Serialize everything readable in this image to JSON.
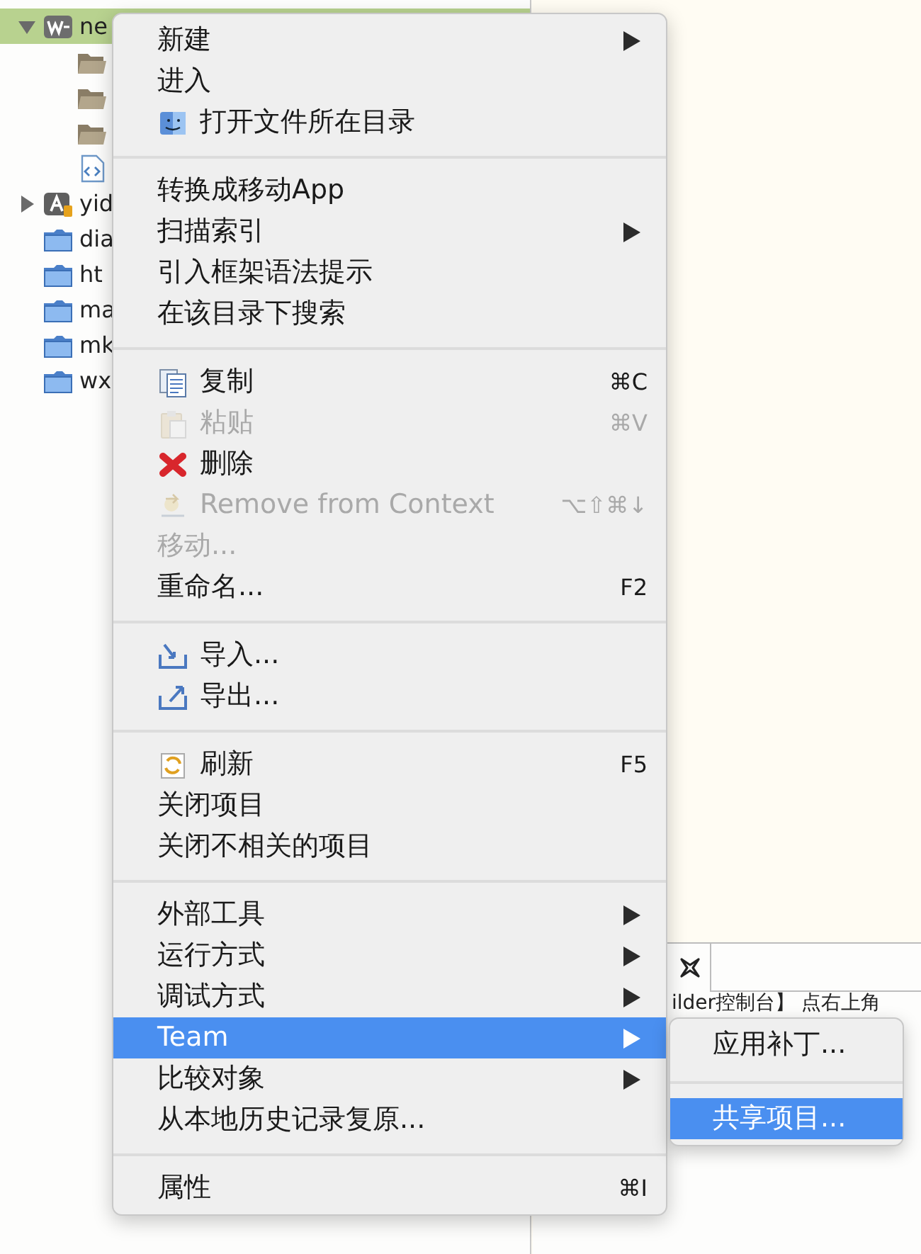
{
  "tree": [
    {
      "kind": "web-project",
      "label": "ne",
      "expanded": true,
      "selected": true,
      "children": [
        {
          "kind": "open-folder"
        },
        {
          "kind": "open-folder"
        },
        {
          "kind": "open-folder"
        },
        {
          "kind": "code-file"
        }
      ]
    },
    {
      "kind": "app-project",
      "label": "yid",
      "expanded": false,
      "selected": false
    },
    {
      "kind": "folder",
      "label": "dia",
      "selected": false
    },
    {
      "kind": "folder",
      "label": "ht",
      "selected": false
    },
    {
      "kind": "folder",
      "label": "ma",
      "selected": false
    },
    {
      "kind": "folder",
      "label": "mk",
      "selected": false
    },
    {
      "kind": "folder",
      "label": "wx",
      "selected": false
    }
  ],
  "console": {
    "text": "ilder控制台】 点右上角"
  },
  "context_menu": {
    "sections": [
      [
        {
          "label": "新建",
          "submenu": true,
          "disabled": false,
          "selected": false
        },
        {
          "label": "进入",
          "submenu": false,
          "disabled": false,
          "selected": false
        },
        {
          "label": "打开文件所在目录",
          "kind": "finder",
          "submenu": false,
          "disabled": false,
          "selected": false
        }
      ],
      [
        {
          "label": "转换成移动App",
          "submenu": false,
          "disabled": false,
          "selected": false
        },
        {
          "label": "扫描索引",
          "submenu": true,
          "disabled": false,
          "selected": false
        },
        {
          "label": "引入框架语法提示",
          "submenu": false,
          "disabled": false,
          "selected": false
        },
        {
          "label": "在该目录下搜索",
          "submenu": false,
          "disabled": false,
          "selected": false
        }
      ],
      [
        {
          "label": "复制",
          "kind": "copy",
          "shortcut": "⌘C",
          "submenu": false,
          "disabled": false,
          "selected": false
        },
        {
          "label": "粘贴",
          "kind": "paste",
          "shortcut": "⌘V",
          "submenu": false,
          "disabled": true,
          "selected": false
        },
        {
          "label": "删除",
          "kind": "delete",
          "submenu": false,
          "disabled": false,
          "selected": false
        },
        {
          "label": "Remove from Context",
          "kind": "remove",
          "shortcut": "⌥⇧⌘↓",
          "submenu": false,
          "disabled": true,
          "selected": false
        },
        {
          "label": "移动...",
          "submenu": false,
          "disabled": true,
          "selected": false
        },
        {
          "label": "重命名...",
          "shortcut": "F2",
          "submenu": false,
          "disabled": false,
          "selected": false
        }
      ],
      [
        {
          "label": "导入...",
          "kind": "import",
          "submenu": false,
          "disabled": false,
          "selected": false
        },
        {
          "label": "导出...",
          "kind": "export",
          "submenu": false,
          "disabled": false,
          "selected": false
        }
      ],
      [
        {
          "label": "刷新",
          "kind": "refresh",
          "shortcut": "F5",
          "submenu": false,
          "disabled": false,
          "selected": false
        },
        {
          "label": "关闭项目",
          "submenu": false,
          "disabled": false,
          "selected": false
        },
        {
          "label": "关闭不相关的项目",
          "submenu": false,
          "disabled": false,
          "selected": false
        }
      ],
      [
        {
          "label": "外部工具",
          "submenu": true,
          "disabled": false,
          "selected": false
        },
        {
          "label": "运行方式",
          "submenu": true,
          "disabled": false,
          "selected": false
        },
        {
          "label": "调试方式",
          "submenu": true,
          "disabled": false,
          "selected": false
        },
        {
          "label": "Team",
          "submenu": true,
          "disabled": false,
          "selected": true
        },
        {
          "label": "比较对象",
          "submenu": true,
          "disabled": false,
          "selected": false
        },
        {
          "label": "从本地历史记录复原...",
          "submenu": false,
          "disabled": false,
          "selected": false
        }
      ],
      [
        {
          "label": "属性",
          "shortcut": "⌘I",
          "submenu": false,
          "disabled": false,
          "selected": false
        }
      ]
    ]
  },
  "submenu": {
    "sections": [
      [
        {
          "label": "应用补丁...",
          "selected": false
        }
      ],
      [
        {
          "label": "共享项目...",
          "selected": true
        }
      ]
    ]
  }
}
